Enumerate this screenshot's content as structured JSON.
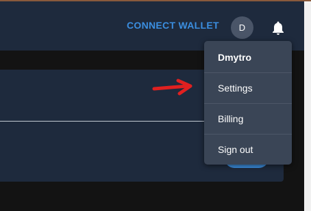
{
  "header": {
    "connect_wallet_label": "CONNECT WALLET",
    "avatar_initial": "D",
    "notification_icon": "bell-icon"
  },
  "user_menu": {
    "user_name": "Dmytro",
    "items": [
      {
        "label": "Settings"
      },
      {
        "label": "Billing"
      },
      {
        "label": "Sign out"
      }
    ]
  },
  "annotation": {
    "icon": "red-arrow-icon",
    "color": "#e02020"
  },
  "colors": {
    "header_bg": "#1e2a3d",
    "page_bg": "#131313",
    "accent": "#3b8ee0",
    "menu_bg": "#3a4556"
  }
}
